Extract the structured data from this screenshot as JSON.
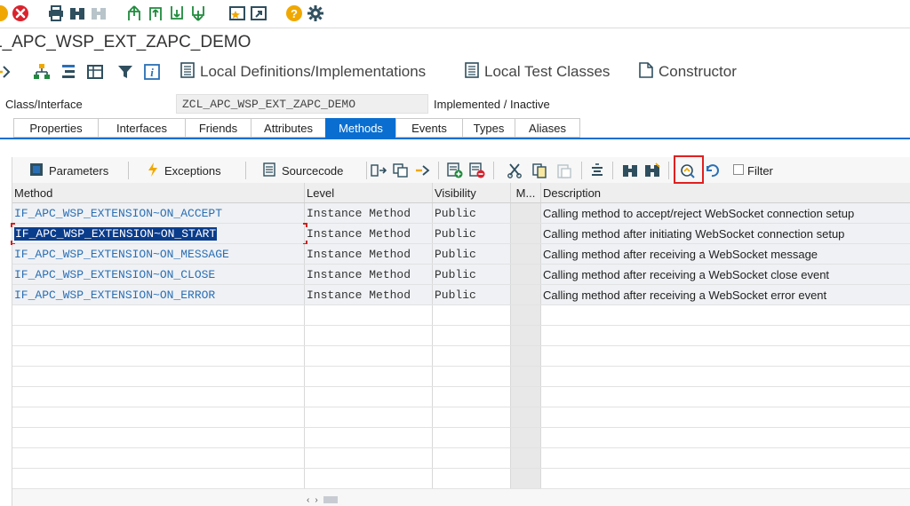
{
  "window": {
    "title": "L_APC_WSP_EXT_ZAPC_DEMO"
  },
  "system_toolbar": {
    "icons": [
      "warning-icon",
      "cancel-icon",
      "print-icon",
      "find-icon",
      "find-next-icon",
      "first-page-icon",
      "previous-page-icon",
      "next-page-icon",
      "last-page-icon",
      "create-session-icon",
      "shortcut-icon",
      "help-icon",
      "settings-icon"
    ]
  },
  "app_toolbar": {
    "local_definitions_label": "Local Definitions/Implementations",
    "local_test_classes_label": "Local Test Classes",
    "constructor_label": "Constructor"
  },
  "class_header": {
    "label": "Class/Interface",
    "value": "ZCL_APC_WSP_EXT_ZAPC_DEMO",
    "status": "Implemented / Inactive"
  },
  "tabs": [
    {
      "label": "Properties",
      "active": false
    },
    {
      "label": "Interfaces",
      "active": false
    },
    {
      "label": "Friends",
      "active": false
    },
    {
      "label": "Attributes",
      "active": false
    },
    {
      "label": "Methods",
      "active": true
    },
    {
      "label": "Events",
      "active": false
    },
    {
      "label": "Types",
      "active": false
    },
    {
      "label": "Aliases",
      "active": false
    }
  ],
  "grid_toolbar": {
    "parameters_label": "Parameters",
    "exceptions_label": "Exceptions",
    "sourcecode_label": "Sourcecode",
    "filter_label": "Filter"
  },
  "grid": {
    "headers": {
      "method": "Method",
      "level": "Level",
      "visibility": "Visibility",
      "m": "M...",
      "description": "Description"
    },
    "rows": [
      {
        "method": "IF_APC_WSP_EXTENSION~ON_ACCEPT",
        "level": "Instance Method",
        "visibility": "Public",
        "description": "Calling method to accept/reject WebSocket connection setup"
      },
      {
        "method": "IF_APC_WSP_EXTENSION~ON_START",
        "level": "Instance Method",
        "visibility": "Public",
        "description": "Calling method after initiating WebSocket connection setup"
      },
      {
        "method": "IF_APC_WSP_EXTENSION~ON_MESSAGE",
        "level": "Instance Method",
        "visibility": "Public",
        "description": "Calling method after receiving a WebSocket message"
      },
      {
        "method": "IF_APC_WSP_EXTENSION~ON_CLOSE",
        "level": "Instance Method",
        "visibility": "Public",
        "description": "Calling method after receiving a WebSocket close event"
      },
      {
        "method": "IF_APC_WSP_EXTENSION~ON_ERROR",
        "level": "Instance Method",
        "visibility": "Public",
        "description": "Calling method after receiving a WebSocket error event"
      }
    ]
  },
  "colors": {
    "accent": "#0a6ed1",
    "method_link": "#2a6fb5",
    "highlight_box": "#e02020",
    "selection": "#0a3c8c"
  }
}
